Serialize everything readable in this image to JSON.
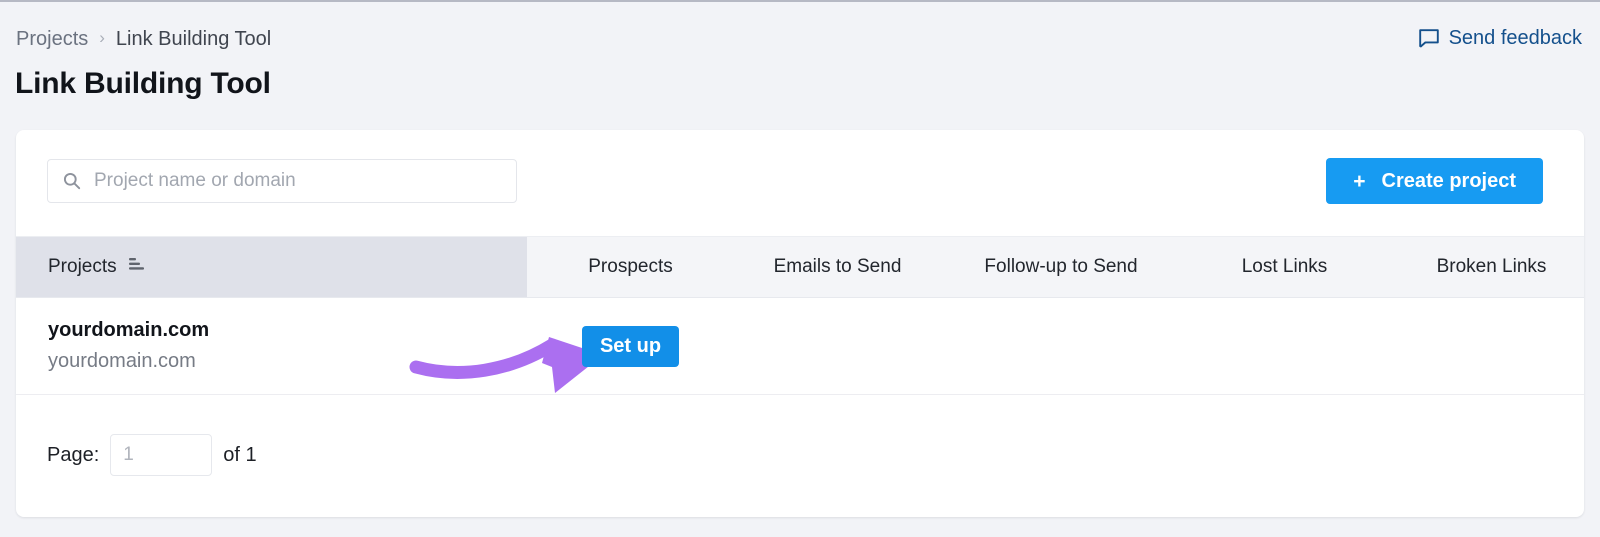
{
  "breadcrumb": {
    "parent": "Projects",
    "separator": "›",
    "current": "Link Building Tool"
  },
  "page_title": "Link Building Tool",
  "feedback": {
    "label": "Send feedback",
    "icon": "speech-bubble-icon",
    "color": "#14508c"
  },
  "toolbar": {
    "search": {
      "placeholder": "Project name or domain",
      "value": "",
      "icon": "search-icon"
    },
    "create_button": {
      "label": "Create project",
      "plus": "+",
      "color": "#179bf2"
    }
  },
  "table": {
    "columns": [
      {
        "label": "Projects",
        "sorted": true,
        "sort_icon": "sort-icon"
      },
      {
        "label": "Prospects",
        "sorted": false
      },
      {
        "label": "Emails to Send",
        "sorted": false
      },
      {
        "label": "Follow-up to Send",
        "sorted": false
      },
      {
        "label": "Lost Links",
        "sorted": false
      },
      {
        "label": "Broken Links",
        "sorted": false
      }
    ],
    "rows": [
      {
        "name": "yourdomain.com",
        "domain": "yourdomain.com",
        "action_label": "Set up",
        "action_color": "#128fe8"
      }
    ]
  },
  "pagination": {
    "label": "Page:",
    "value": "1",
    "placeholder": "1",
    "of_label": "of 1"
  },
  "annotation": {
    "type": "curved-arrow",
    "color": "#ab6ff0",
    "points_to": "Set up"
  }
}
